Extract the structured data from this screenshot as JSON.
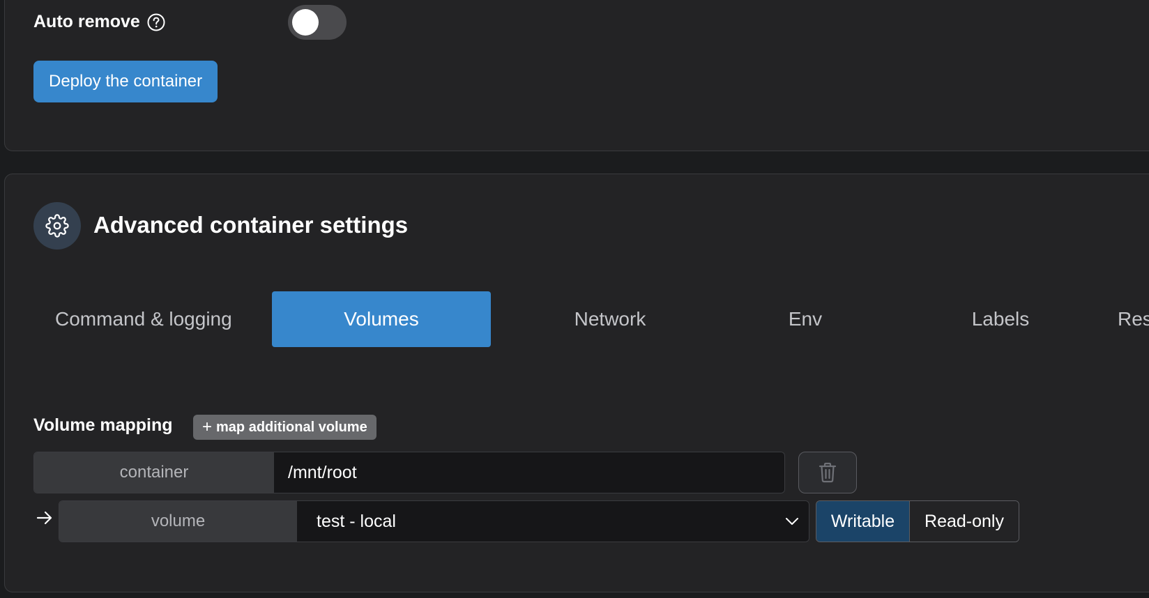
{
  "auto_remove": {
    "label": "Auto remove",
    "enabled": false
  },
  "deploy_button": "Deploy the container",
  "advanced": {
    "title": "Advanced container settings",
    "tabs": [
      {
        "label": "Command & logging",
        "active": false
      },
      {
        "label": "Volumes",
        "active": true
      },
      {
        "label": "Network",
        "active": false
      },
      {
        "label": "Env",
        "active": false
      },
      {
        "label": "Labels",
        "active": false
      },
      {
        "label": "Res",
        "active": false
      }
    ],
    "volume_mapping": {
      "label": "Volume mapping",
      "add_button": "map additional volume",
      "container_label": "container",
      "container_value": "/mnt/root",
      "volume_label": "volume",
      "volume_value": "test - local",
      "modes": [
        "Writable",
        "Read-only"
      ],
      "selected_mode": "Writable"
    }
  },
  "colors": {
    "accent": "#3787cc",
    "background": "#1b1c1e",
    "card": "#232325"
  },
  "icons": [
    "help-icon",
    "gear-icon",
    "plus-icon",
    "trash-icon",
    "arrow-right-icon",
    "chevron-down-icon"
  ]
}
